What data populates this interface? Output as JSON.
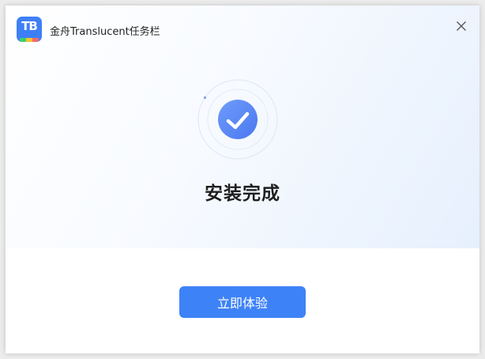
{
  "window": {
    "app_name": "金舟Translucent任务栏",
    "logo": {
      "text": "TB",
      "icon": "app-logo-icon",
      "colors": {
        "background": "#3f7ff6",
        "stripes": [
          "#3ecf6d",
          "#f5c431",
          "#f46b6b"
        ]
      }
    },
    "close_icon": "close-icon"
  },
  "status": {
    "icon": "check-circle-icon",
    "title": "安装完成"
  },
  "actions": {
    "primary_label": "立即体验"
  },
  "colors": {
    "accent": "#3e82f7",
    "hero_gradient_end": "#e6f0fd"
  }
}
